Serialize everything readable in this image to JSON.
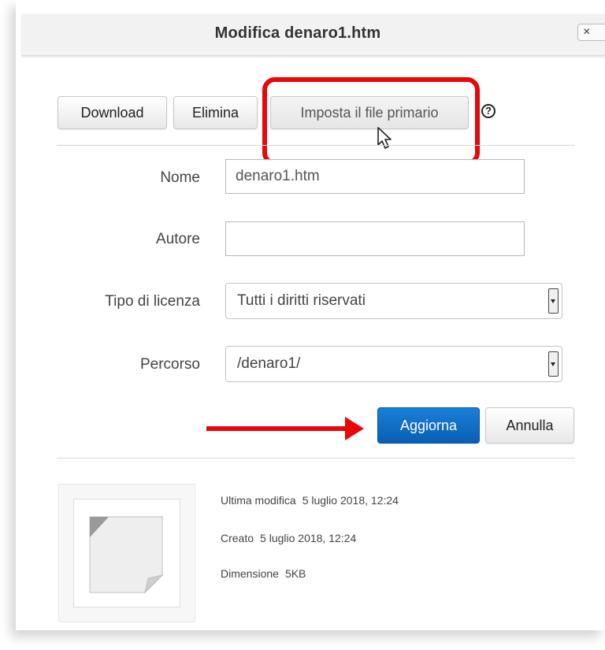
{
  "dialog": {
    "title": "Modifica denaro1.htm",
    "close_label": "×"
  },
  "toolbar": {
    "download_label": "Download",
    "delete_label": "Elimina",
    "set_primary_label": "Imposta il file primario",
    "help_label": "?"
  },
  "form": {
    "name_label": "Nome",
    "name_value": "denaro1.htm",
    "author_label": "Autore",
    "author_value": "",
    "license_label": "Tipo di licenza",
    "license_value": "Tutti i diritti riservati",
    "path_label": "Percorso",
    "path_value": "/denaro1/",
    "update_label": "Aggiorna",
    "cancel_label": "Annulla"
  },
  "info": {
    "modified_label": "Ultima modifica",
    "modified_value": "5 luglio 2018, 12:24",
    "created_label": "Creato",
    "created_value": "5 luglio 2018, 12:24",
    "size_label": "Dimensione",
    "size_value": "5KB"
  },
  "annotations": {
    "highlight_color": "#e8070b",
    "primary_button_color": "#0a6fc8",
    "thumbnail_icon": "file-icon",
    "cursor_icon": "mouse-pointer-icon"
  }
}
